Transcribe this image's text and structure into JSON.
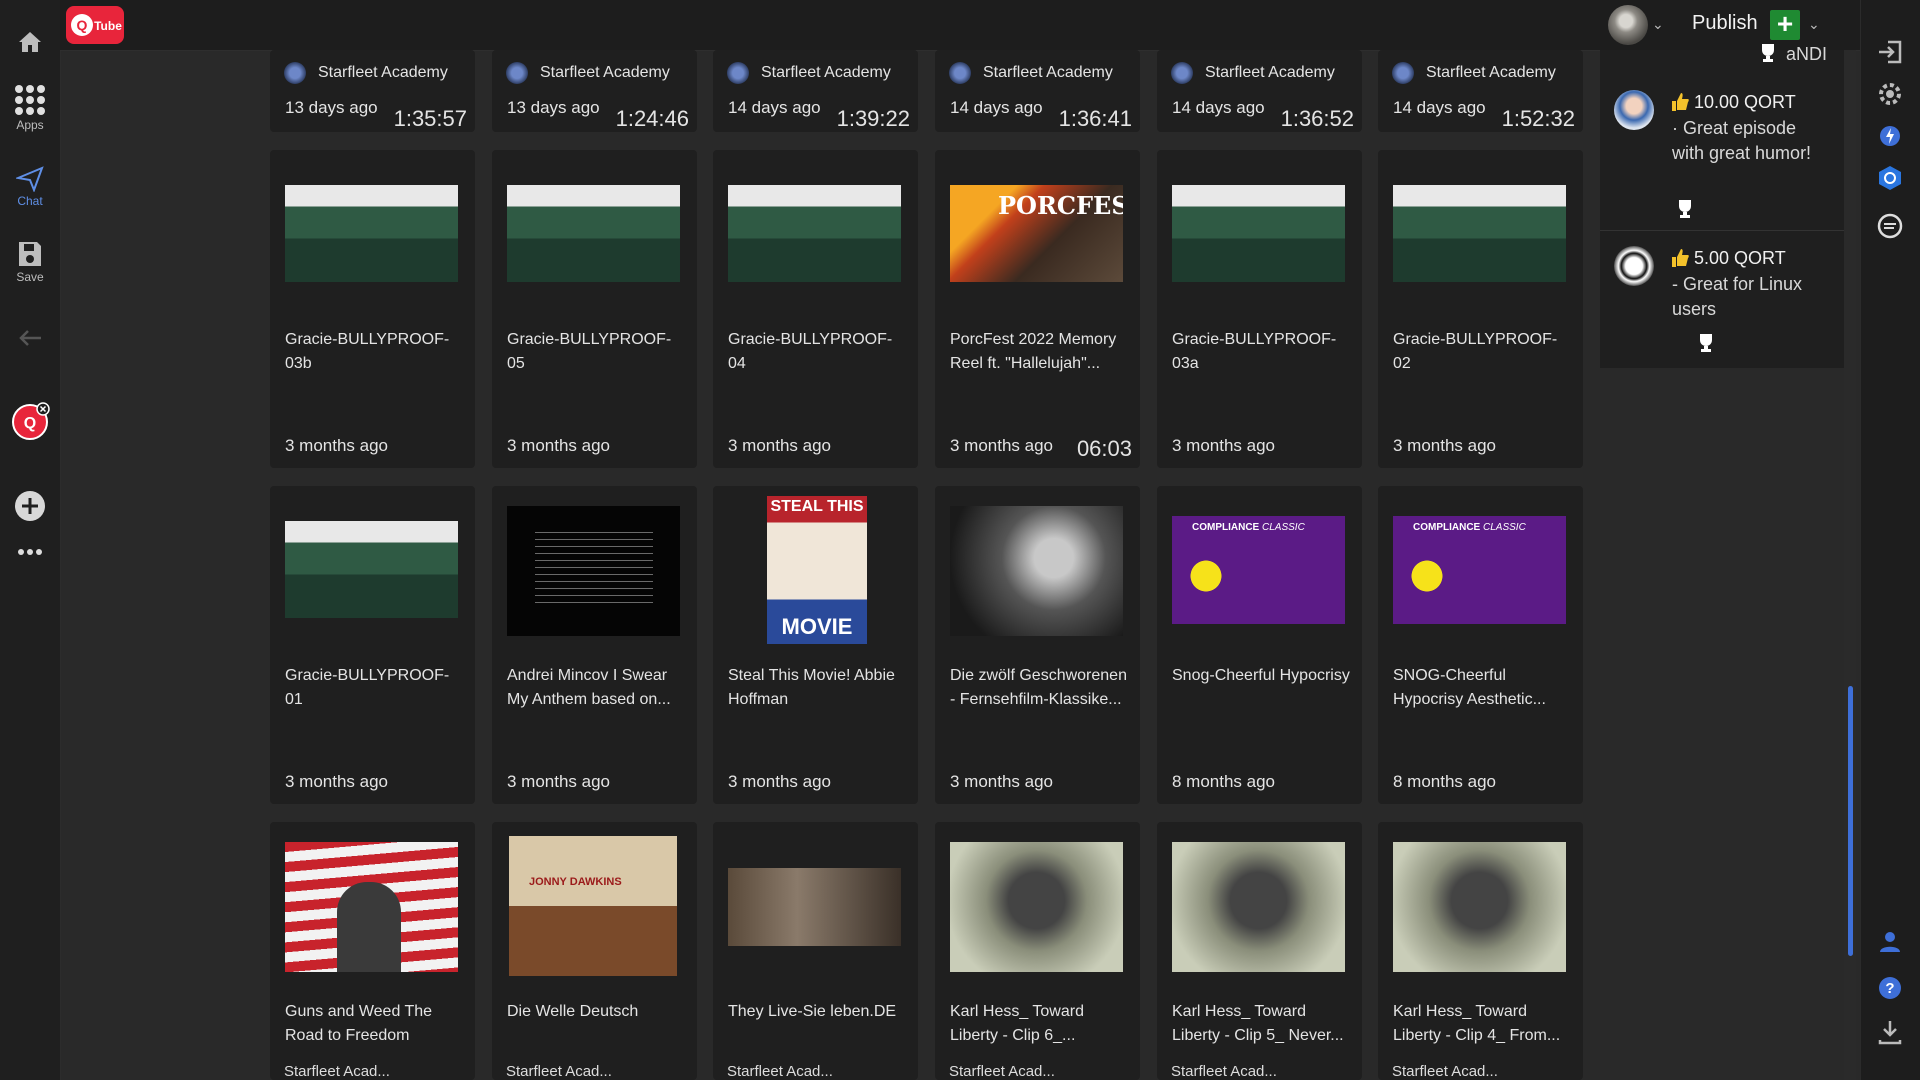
{
  "app": {
    "logo_text": "Tube"
  },
  "leftbar": {
    "apps_label": "Apps",
    "chat_label": "Chat",
    "save_label": "Save"
  },
  "header": {
    "publish_label": "Publish"
  },
  "comments": [
    {
      "amount": "10.00 QORT",
      "text": "· Great episode with great humor!"
    },
    {
      "amount": "5.00 QORT",
      "text": "- Great for Linux users"
    }
  ],
  "comments_partial_name": "aNDI",
  "top_row": [
    {
      "channel": "Starfleet Academy",
      "date": "13 days ago",
      "duration": "1:35:57"
    },
    {
      "channel": "Starfleet Academy",
      "date": "13 days ago",
      "duration": "1:24:46"
    },
    {
      "channel": "Starfleet Academy",
      "date": "14 days ago",
      "duration": "1:39:22"
    },
    {
      "channel": "Starfleet Academy",
      "date": "14 days ago",
      "duration": "1:36:41"
    },
    {
      "channel": "Starfleet Academy",
      "date": "14 days ago",
      "duration": "1:36:52"
    },
    {
      "channel": "Starfleet Academy",
      "date": "14 days ago",
      "duration": "1:52:32"
    }
  ],
  "row2": [
    {
      "title": "Gracie-BULLYPROOF-03b",
      "date": "3 months ago",
      "duration": ""
    },
    {
      "title": "Gracie-BULLYPROOF-05",
      "date": "3 months ago",
      "duration": ""
    },
    {
      "title": "Gracie-BULLYPROOF-04",
      "date": "3 months ago",
      "duration": ""
    },
    {
      "title": "PorcFest 2022 Memory Reel ft. \"Hallelujah\"...",
      "date": "3 months ago",
      "duration": "06:03"
    },
    {
      "title": "Gracie-BULLYPROOF-03a",
      "date": "3 months ago",
      "duration": ""
    },
    {
      "title": "Gracie-BULLYPROOF-02",
      "date": "3 months ago",
      "duration": ""
    }
  ],
  "row3": [
    {
      "title": "Gracie-BULLYPROOF-01",
      "date": "3 months ago"
    },
    {
      "title": "Andrei Mincov I Swear My Anthem based on...",
      "date": "3 months ago"
    },
    {
      "title": "Steal This Movie! Abbie Hoffman",
      "date": "3 months ago"
    },
    {
      "title": "Die zwölf Geschworenen - Fernsehfilm-Klassike...",
      "date": "3 months ago"
    },
    {
      "title": "Snog-Cheerful Hypocrisy",
      "date": "8 months ago"
    },
    {
      "title": "SNOG-Cheerful Hypocrisy Aesthetic...",
      "date": "8 months ago"
    }
  ],
  "row4": [
    {
      "title": "Guns and Weed The Road to Freedom",
      "channel": "Starfleet Acad..."
    },
    {
      "title": "Die Welle Deutsch",
      "channel": "Starfleet Acad..."
    },
    {
      "title": "They Live-Sie leben.DE",
      "channel": "Starfleet Acad..."
    },
    {
      "title": "Karl Hess_ Toward Liberty - Clip 6_...",
      "channel": "Starfleet Acad..."
    },
    {
      "title": "Karl Hess_ Toward Liberty - Clip 5_ Never...",
      "channel": "Starfleet Acad..."
    },
    {
      "title": "Karl Hess_ Toward Liberty - Clip 4_ From...",
      "channel": "Starfleet Acad..."
    }
  ],
  "thumb_texts": {
    "porcfest": "PORCFEST",
    "steal_this": "STEAL THIS",
    "movie": "MOVIE",
    "compliance": "COMPLIANCE",
    "classic": "CLASSIC",
    "jonny": "JONNY DAWKINS"
  },
  "colors": {
    "accent": "#3e6fd8",
    "publish_green": "#1f8a32",
    "logo_red": "#e8253b"
  }
}
